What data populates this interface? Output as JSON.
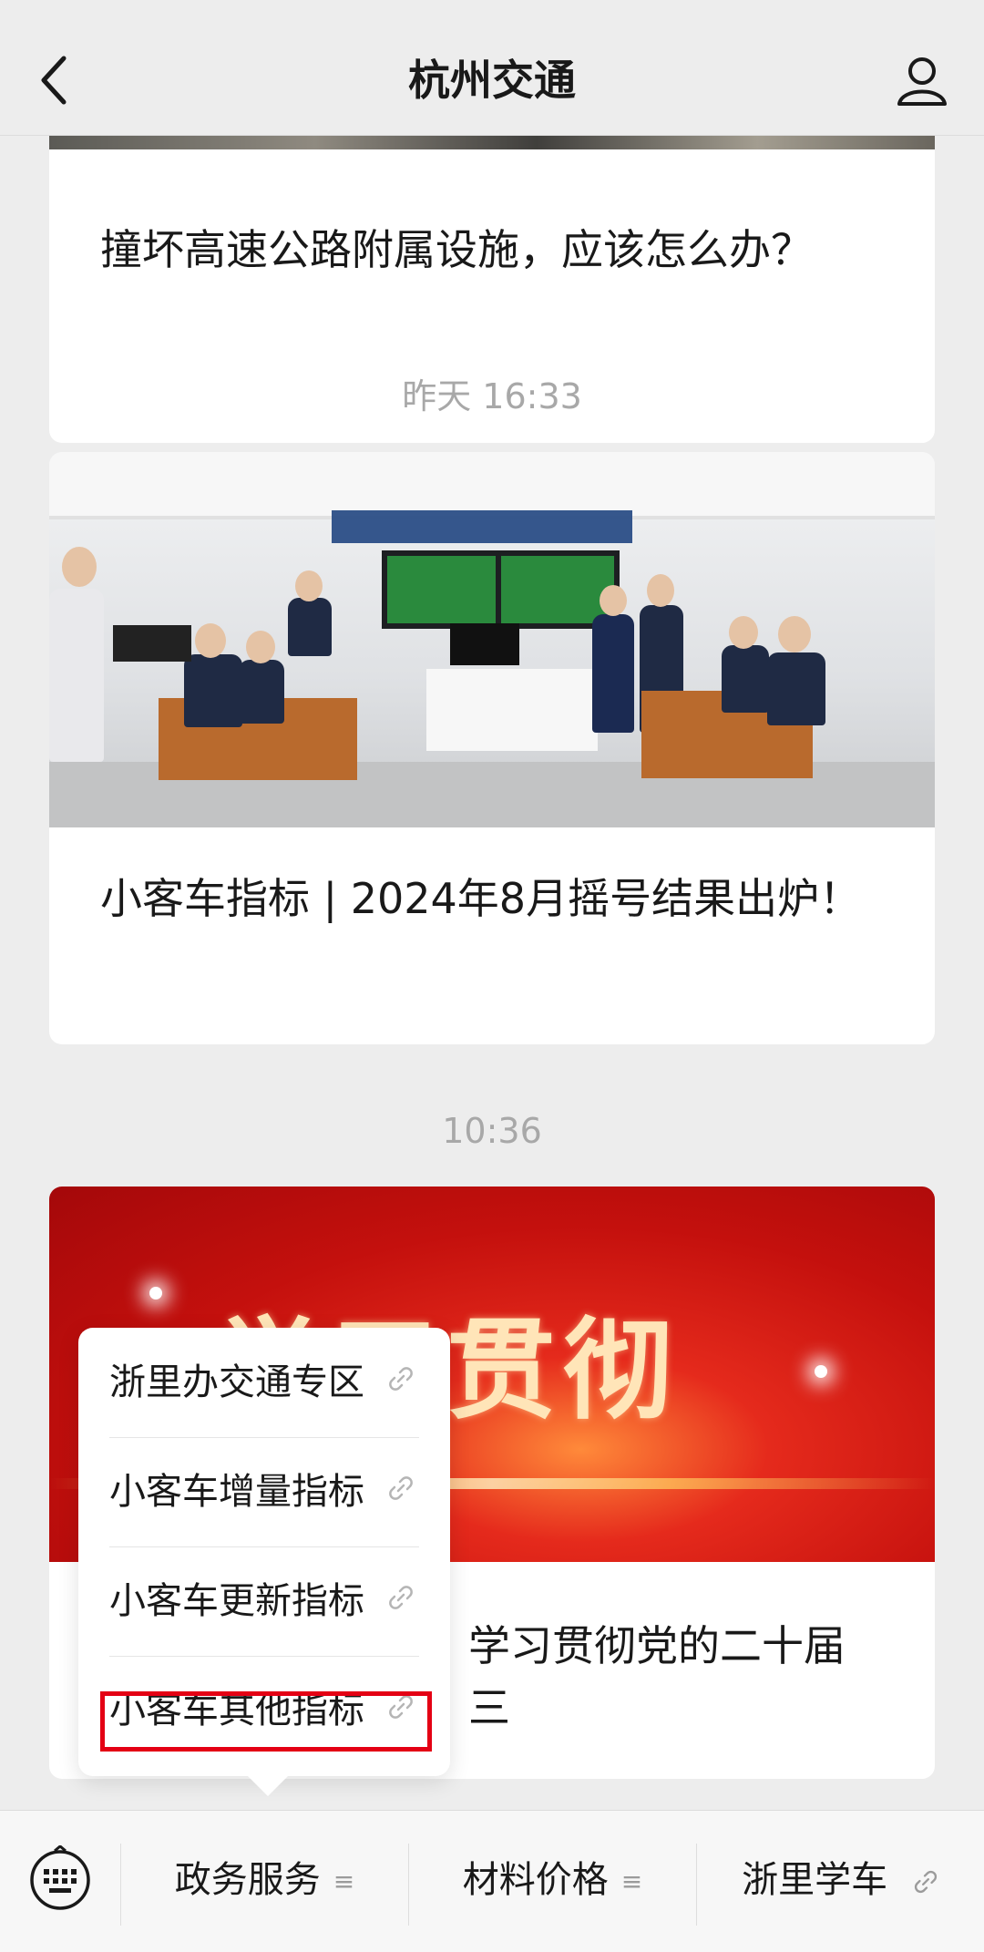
{
  "header": {
    "title": "杭州交通",
    "back_icon": "chevron-left-icon",
    "profile_icon": "user-icon"
  },
  "feed": {
    "card1": {
      "caption": "撞坏高速公路附属设施，应该怎么办？"
    },
    "timestamp1": "昨天 16:33",
    "card2": {
      "caption": "小客车指标 | 2024年8月摇号结果出炉！"
    },
    "timestamp2": "10:36",
    "card3": {
      "banner_text": "学习贯彻",
      "caption_partial": "学习贯彻党的二十届三"
    }
  },
  "popup_menu": {
    "items": [
      {
        "label": "浙里办交通专区",
        "icon": "link-icon"
      },
      {
        "label": "小客车增量指标",
        "icon": "link-icon"
      },
      {
        "label": "小客车更新指标",
        "icon": "link-icon"
      },
      {
        "label": "小客车其他指标",
        "icon": "link-icon",
        "highlighted": true
      }
    ],
    "highlight_color": "#e40014"
  },
  "bottom_menu": {
    "keyboard_icon": "keyboard-icon",
    "buttons": [
      {
        "label": "政务服务",
        "icon": "menu-lines-icon"
      },
      {
        "label": "材料价格",
        "icon": "menu-lines-icon"
      },
      {
        "label": "浙里学车",
        "icon": "link-icon"
      }
    ]
  }
}
